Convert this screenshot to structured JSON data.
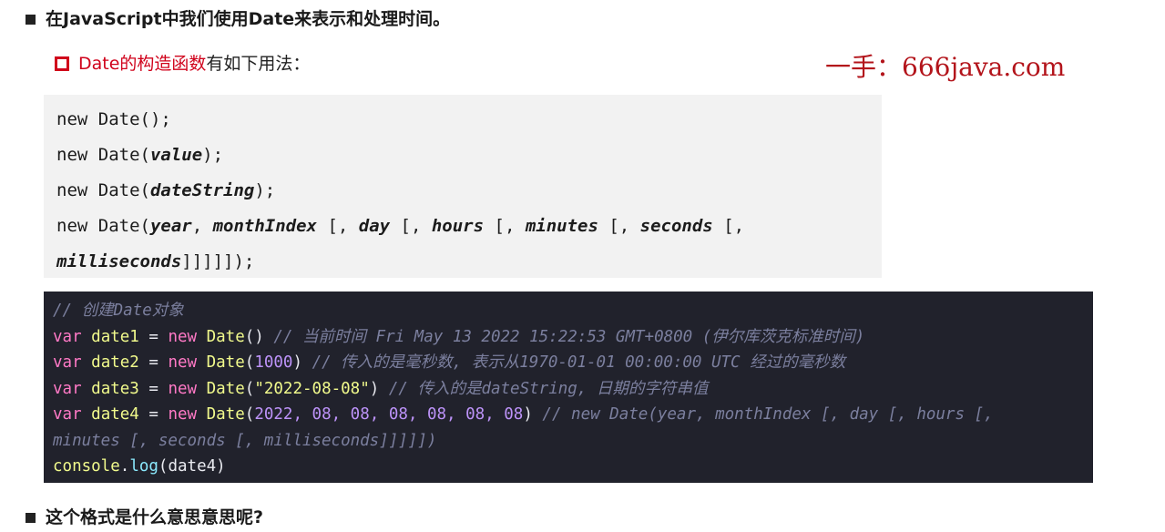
{
  "heading1": "在JavaScript中我们使用Date来表示和处理时间。",
  "subline": {
    "red_text": "Date的构造函数",
    "dark_text": "有如下用法："
  },
  "watermark": "一手：666java.com",
  "syntax": {
    "l1": "new Date();",
    "l2_pre": "new Date(",
    "l2_arg": "value",
    "l2_post": ");",
    "l3_pre": "new Date(",
    "l3_arg": "dateString",
    "l3_post": ");",
    "l4_pre": "new Date(",
    "l4_a1": "year",
    "l4_s1": ", ",
    "l4_a2": "monthIndex",
    "l4_s2": " [, ",
    "l4_a3": "day",
    "l4_s3": " [, ",
    "l4_a4": "hours",
    "l4_s4": " [, ",
    "l4_a5": "minutes",
    "l4_s5": " [, ",
    "l4_a6": "seconds",
    "l4_s6": " [,",
    "l5_arg": "milliseconds",
    "l5_post": "]]]]]);"
  },
  "code": {
    "comment0": "// 创建Date对象",
    "kw_var": "var",
    "kw_new": "new",
    "eq": " = ",
    "date_fn": "Date",
    "line1_var": "date1",
    "line1_args": "()",
    "line1_comment": "// 当前时间 Fri May 13 2022 15:22:53 GMT+0800 (伊尔库茨克标准时间)",
    "line2_var": "date2",
    "line2_open": "(",
    "line2_num": "1000",
    "line2_close": ")",
    "line2_comment": "// 传入的是毫秒数, 表示从1970-01-01 00:00:00 UTC 经过的毫秒数",
    "line3_var": "date3",
    "line3_open": "(",
    "line3_str": "\"2022-08-08\"",
    "line3_close": ")",
    "line3_comment": "// 传入的是dateString, 日期的字符串值",
    "line4_var": "date4",
    "line4_open": "(",
    "line4_nums": "2022, 08, 08, 08, 08, 08, 08",
    "line4_close": ")",
    "line4_comment": "// new Date(year, monthIndex [, day [, hours [,",
    "line5_comment": "minutes [, seconds [, milliseconds]]]]])",
    "line6_obj": "console",
    "line6_dot": ".",
    "line6_meth": "log",
    "line6_args": "(date4)"
  },
  "heading2": "这个格式是什么意思意思呢?"
}
